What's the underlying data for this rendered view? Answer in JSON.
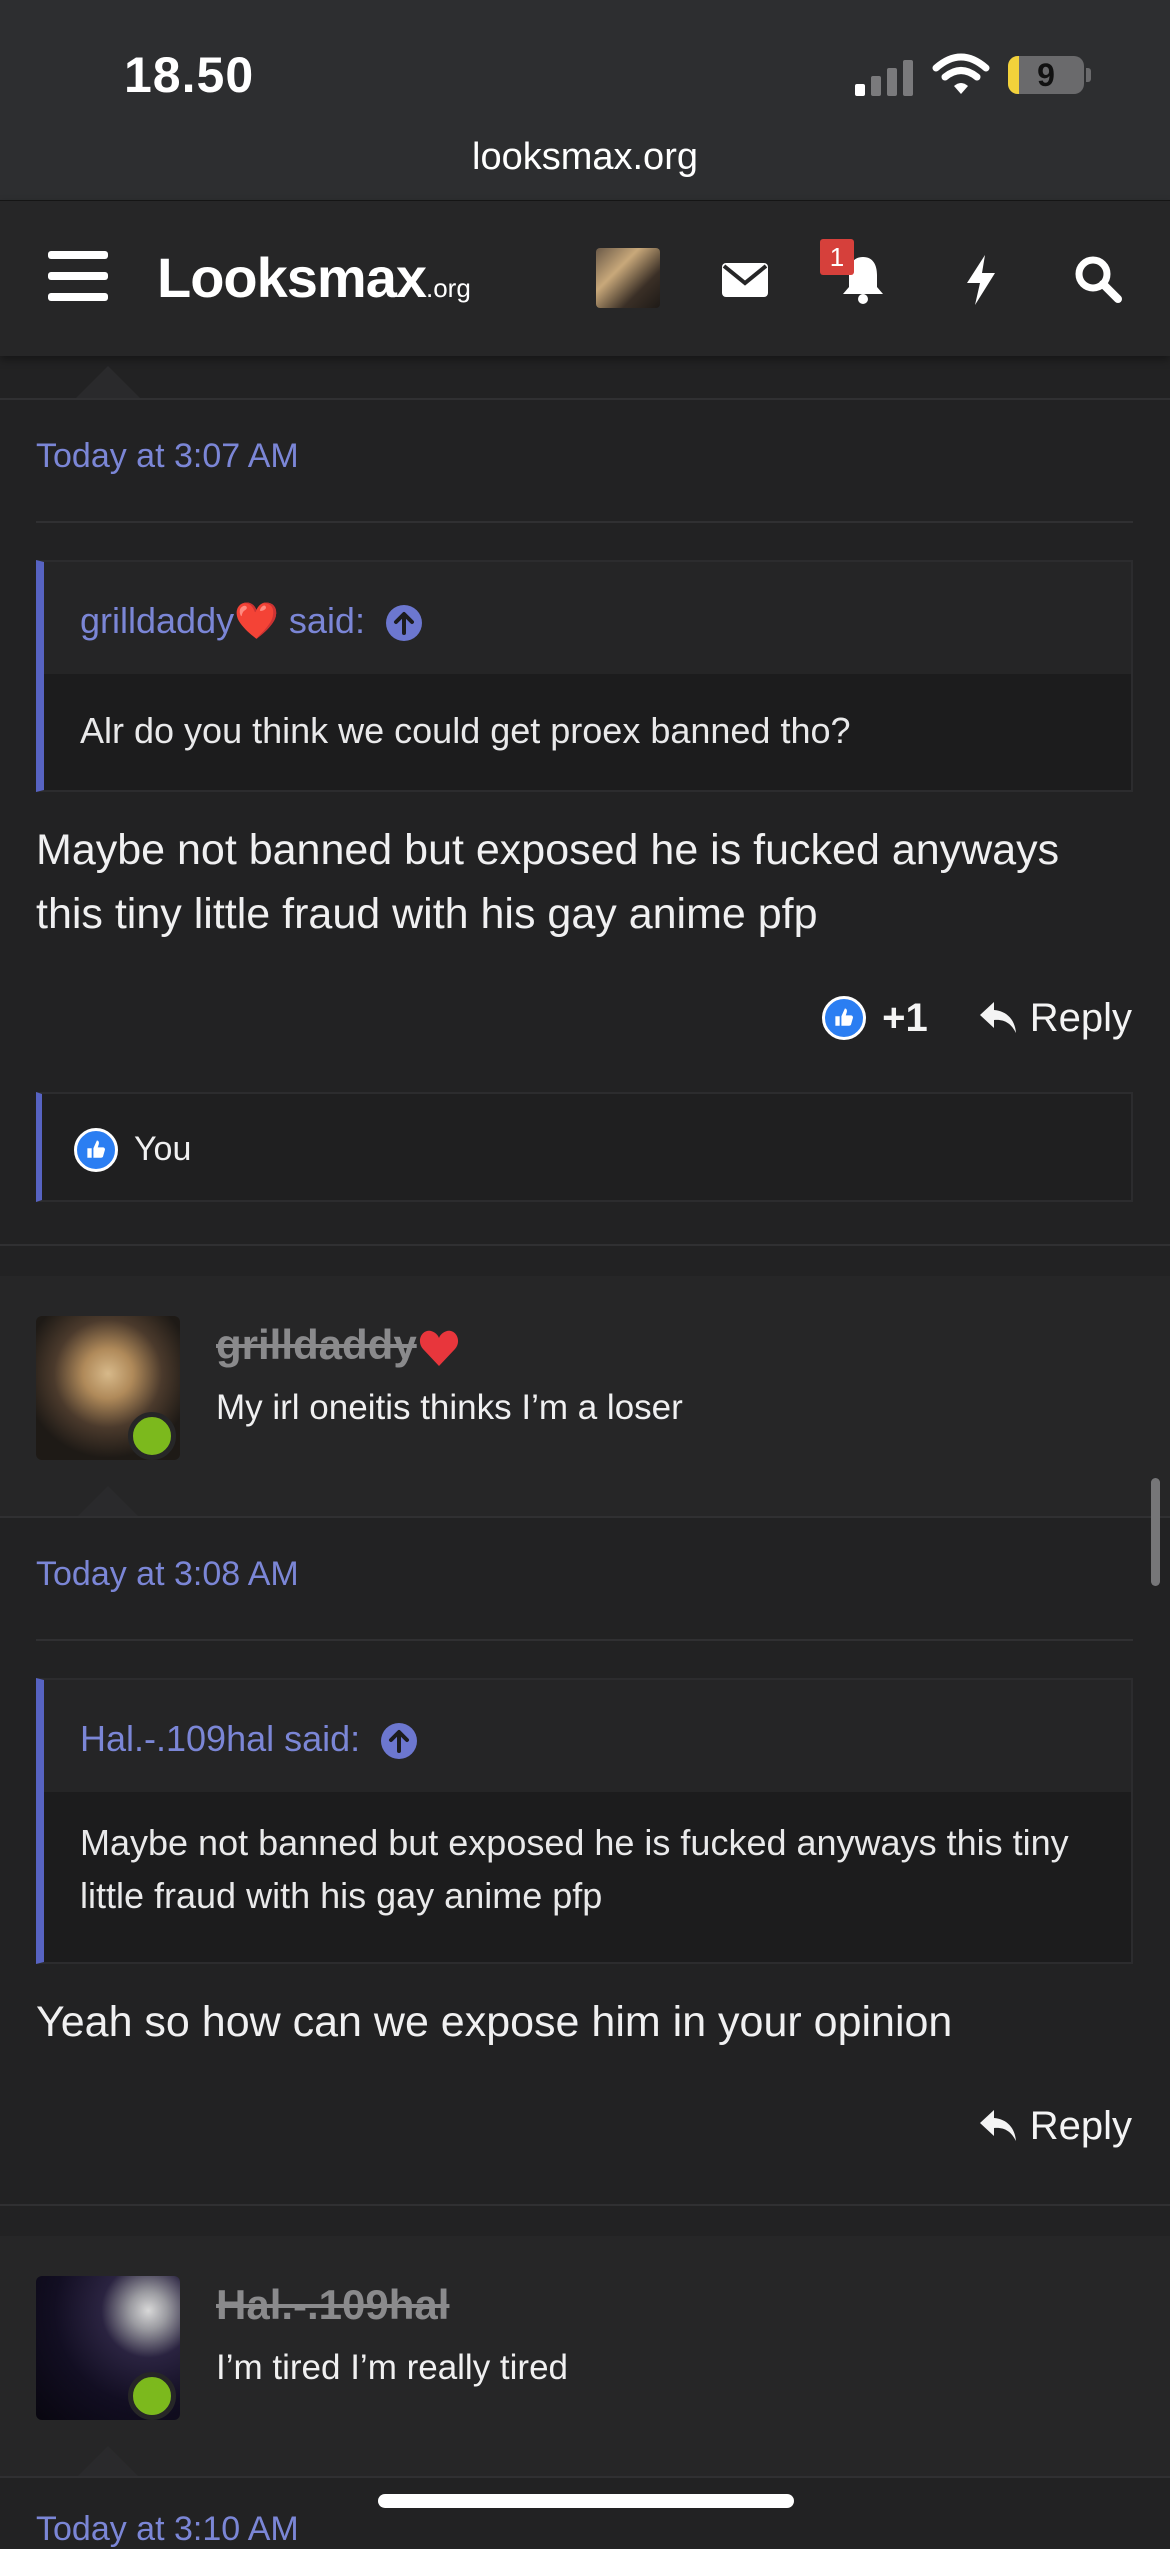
{
  "status": {
    "time": "18.50",
    "battery": "9",
    "url": "looksmax.org"
  },
  "header": {
    "logo_main": "Looksmax",
    "logo_suffix": ".org",
    "alerts_count": "1"
  },
  "posts": [
    {
      "timestamp": "Today at 3:07 AM",
      "quote": {
        "author": "grilldaddy❤️ said:",
        "text": "Alr do you think we could get proex banned tho?"
      },
      "body": "Maybe not banned but exposed he is fucked anyways this tiny little fraud with his gay anime pfp",
      "reaction_count": "+1",
      "reply_label": "Reply",
      "reactors": "You"
    },
    {
      "user": {
        "name": "grilldaddy",
        "title": "My irl oneitis thinks I’m a loser"
      },
      "timestamp": "Today at 3:08 AM",
      "quote": {
        "author": "Hal.-.109hal said:",
        "text": "Maybe not banned but exposed he is fucked anyways this tiny little fraud with his gay anime pfp"
      },
      "body": "Yeah so how can we expose him in your opinion",
      "reply_label": "Reply"
    },
    {
      "user": {
        "name": "Hal.-.109hal",
        "title": "I’m tired I’m really tired"
      },
      "timestamp": "Today at 3:10 AM"
    }
  ],
  "colors": {
    "accent": "#7b86d6",
    "quote_bar": "#5763c2",
    "online": "#7cb91d",
    "like": "#2b7ef2",
    "badge": "#d6403b"
  }
}
